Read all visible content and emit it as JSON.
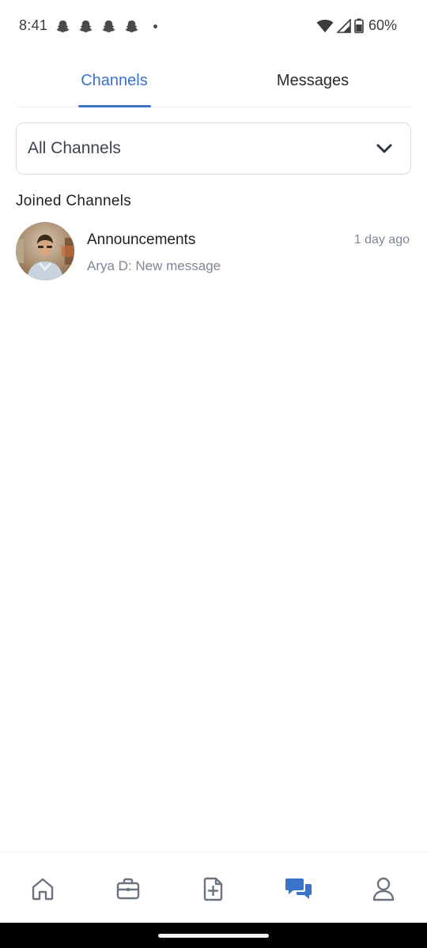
{
  "status_bar": {
    "time": "8:41",
    "battery": "60%",
    "notification_icons": [
      "snapchat-icon",
      "snapchat-icon",
      "snapchat-icon",
      "snapchat-icon"
    ]
  },
  "tabs": [
    {
      "label": "Channels",
      "active": true
    },
    {
      "label": "Messages",
      "active": false
    }
  ],
  "filter": {
    "selected": "All Channels"
  },
  "section": {
    "title": "Joined Channels"
  },
  "channels": [
    {
      "name": "Announcements",
      "preview": "Arya D: New message",
      "time": "1 day ago"
    }
  ],
  "bottom_nav": [
    {
      "icon": "home-icon",
      "active": false
    },
    {
      "icon": "briefcase-icon",
      "active": false
    },
    {
      "icon": "add-document-icon",
      "active": false
    },
    {
      "icon": "chat-icon",
      "active": true
    },
    {
      "icon": "profile-icon",
      "active": false
    }
  ],
  "colors": {
    "accent": "#3a73c8",
    "muted_text": "#7d8794",
    "nav_icon": "#6b7280"
  }
}
